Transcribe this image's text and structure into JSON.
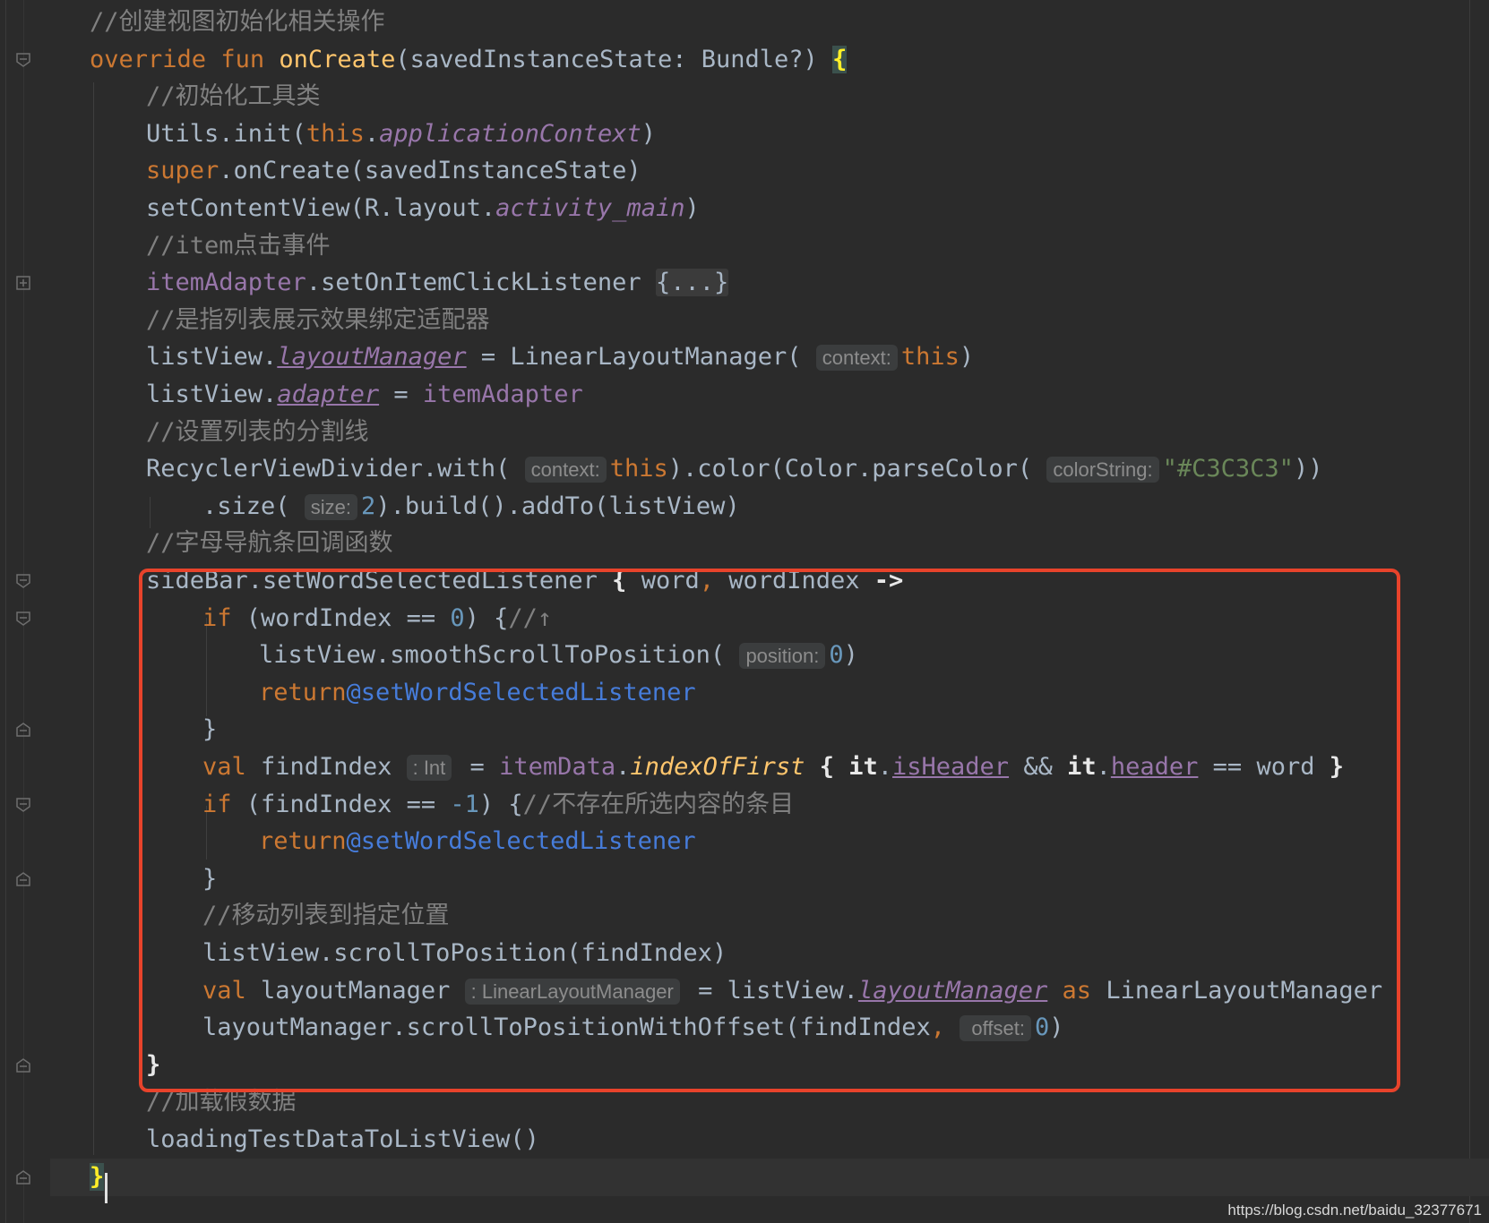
{
  "colors": {
    "background": "#2b2b2b",
    "keyword": "#cc7832",
    "function": "#ffc66d",
    "comment": "#808080",
    "property": "#9876aa",
    "label": "#467cda",
    "number": "#6897bb",
    "string": "#6a8759",
    "highlight_box": "#e8432b"
  },
  "code_lines": [
    {
      "indent": 0,
      "segs": [
        {
          "t": "//创建视图初始化相关操作",
          "c": "comment"
        }
      ]
    },
    {
      "indent": 0,
      "segs": [
        {
          "t": "override ",
          "c": "kw"
        },
        {
          "t": "fun ",
          "c": "kw"
        },
        {
          "t": "onCreate",
          "c": "fn"
        },
        {
          "t": "(savedInstanceState: Bundle?) ",
          "c": "plain"
        },
        {
          "t": "{",
          "c": "bracehl"
        }
      ]
    },
    {
      "indent": 1,
      "segs": [
        {
          "t": "//初始化工具类",
          "c": "comment"
        }
      ]
    },
    {
      "indent": 1,
      "segs": [
        {
          "t": "Utils.init(",
          "c": "plain"
        },
        {
          "t": "this",
          "c": "kw"
        },
        {
          "t": ".",
          "c": "plain"
        },
        {
          "t": "applicationContext",
          "c": "prop"
        },
        {
          "t": ")",
          "c": "plain"
        }
      ]
    },
    {
      "indent": 1,
      "segs": [
        {
          "t": "super",
          "c": "kw"
        },
        {
          "t": ".onCreate(savedInstanceState)",
          "c": "plain"
        }
      ]
    },
    {
      "indent": 1,
      "segs": [
        {
          "t": "setContentView(R.layout.",
          "c": "plain"
        },
        {
          "t": "activity_main",
          "c": "prop"
        },
        {
          "t": ")",
          "c": "plain"
        }
      ]
    },
    {
      "indent": 1,
      "segs": [
        {
          "t": "//item点击事件",
          "c": "comment"
        }
      ]
    },
    {
      "indent": 1,
      "segs": [
        {
          "t": "itemAdapter",
          "c": "field"
        },
        {
          "t": ".setOnItemClickListener ",
          "c": "plain"
        },
        {
          "t": "{...}",
          "c": "fold"
        }
      ]
    },
    {
      "indent": 1,
      "segs": [
        {
          "t": "//是指列表展示效果绑定适配器",
          "c": "comment"
        }
      ]
    },
    {
      "indent": 1,
      "segs": [
        {
          "t": "listView.",
          "c": "plain"
        },
        {
          "t": "layoutManager",
          "c": "propu"
        },
        {
          "t": " = LinearLayoutManager( ",
          "c": "plain"
        },
        {
          "t": "context:",
          "c": "hint"
        },
        {
          "t": "this",
          "c": "kw"
        },
        {
          "t": ")",
          "c": "plain"
        }
      ]
    },
    {
      "indent": 1,
      "segs": [
        {
          "t": "listView.",
          "c": "plain"
        },
        {
          "t": "adapter",
          "c": "propu"
        },
        {
          "t": " = ",
          "c": "plain"
        },
        {
          "t": "itemAdapter",
          "c": "field"
        }
      ]
    },
    {
      "indent": 1,
      "segs": [
        {
          "t": "//设置列表的分割线",
          "c": "comment"
        }
      ]
    },
    {
      "indent": 1,
      "segs": [
        {
          "t": "RecyclerViewDivider.with( ",
          "c": "plain"
        },
        {
          "t": "context:",
          "c": "hint"
        },
        {
          "t": "this",
          "c": "kw"
        },
        {
          "t": ").color(Color.parseColor( ",
          "c": "plain"
        },
        {
          "t": "colorString:",
          "c": "hint"
        },
        {
          "t": "\"#C3C3C3\"",
          "c": "str"
        },
        {
          "t": "))",
          "c": "plain"
        }
      ]
    },
    {
      "indent": 2,
      "segs": [
        {
          "t": ".size( ",
          "c": "plain"
        },
        {
          "t": "size:",
          "c": "hint"
        },
        {
          "t": "2",
          "c": "num"
        },
        {
          "t": ").build().addTo(listView)",
          "c": "plain"
        }
      ]
    },
    {
      "indent": 1,
      "segs": [
        {
          "t": "//字母导航条回调函数",
          "c": "comment"
        }
      ]
    },
    {
      "indent": 1,
      "segs": [
        {
          "t": "sideBar.setWordSelectedListener ",
          "c": "plain"
        },
        {
          "t": "{",
          "c": "brace"
        },
        {
          "t": " word",
          "c": "plain"
        },
        {
          "t": ",",
          "c": "kw"
        },
        {
          "t": " wordIndex ",
          "c": "plain"
        },
        {
          "t": "->",
          "c": "brace"
        }
      ]
    },
    {
      "indent": 2,
      "segs": [
        {
          "t": "if ",
          "c": "kw"
        },
        {
          "t": "(wordIndex == ",
          "c": "plain"
        },
        {
          "t": "0",
          "c": "num"
        },
        {
          "t": ") {",
          "c": "plain"
        },
        {
          "t": "//↑",
          "c": "comment"
        }
      ]
    },
    {
      "indent": 3,
      "segs": [
        {
          "t": "listView.smoothScrollToPosition( ",
          "c": "plain"
        },
        {
          "t": "position:",
          "c": "hint"
        },
        {
          "t": "0",
          "c": "num"
        },
        {
          "t": ")",
          "c": "plain"
        }
      ]
    },
    {
      "indent": 3,
      "segs": [
        {
          "t": "return",
          "c": "kw"
        },
        {
          "t": "@setWordSelectedListener",
          "c": "label"
        }
      ]
    },
    {
      "indent": 2,
      "segs": [
        {
          "t": "}",
          "c": "plain"
        }
      ]
    },
    {
      "indent": 2,
      "segs": [
        {
          "t": "val ",
          "c": "kw"
        },
        {
          "t": "findIndex ",
          "c": "plain"
        },
        {
          "t": ": Int",
          "c": "hint"
        },
        {
          "t": " = ",
          "c": "plain"
        },
        {
          "t": "itemData",
          "c": "field"
        },
        {
          "t": ".",
          "c": "plain"
        },
        {
          "t": "indexOfFirst",
          "c": "fn-it"
        },
        {
          "t": " { ",
          "c": "brace"
        },
        {
          "t": "it",
          "c": "brace"
        },
        {
          "t": ".",
          "c": "plain"
        },
        {
          "t": "isHeader",
          "c": "fieldu"
        },
        {
          "t": " && ",
          "c": "plain"
        },
        {
          "t": "it",
          "c": "brace"
        },
        {
          "t": ".",
          "c": "plain"
        },
        {
          "t": "header",
          "c": "fieldu"
        },
        {
          "t": " == word ",
          "c": "plain"
        },
        {
          "t": "}",
          "c": "brace"
        }
      ]
    },
    {
      "indent": 2,
      "segs": [
        {
          "t": "if ",
          "c": "kw"
        },
        {
          "t": "(findIndex == ",
          "c": "plain"
        },
        {
          "t": "-1",
          "c": "num"
        },
        {
          "t": ") {",
          "c": "plain"
        },
        {
          "t": "//不存在所选内容的条目",
          "c": "comment"
        }
      ]
    },
    {
      "indent": 3,
      "segs": [
        {
          "t": "return",
          "c": "kw"
        },
        {
          "t": "@setWordSelectedListener",
          "c": "label"
        }
      ]
    },
    {
      "indent": 2,
      "segs": [
        {
          "t": "}",
          "c": "plain"
        }
      ]
    },
    {
      "indent": 2,
      "segs": [
        {
          "t": "//移动列表到指定位置",
          "c": "comment"
        }
      ]
    },
    {
      "indent": 2,
      "segs": [
        {
          "t": "listView.scrollToPosition(findIndex)",
          "c": "plain"
        }
      ]
    },
    {
      "indent": 2,
      "segs": [
        {
          "t": "val ",
          "c": "kw"
        },
        {
          "t": "layoutManager ",
          "c": "plain"
        },
        {
          "t": ": LinearLayoutManager",
          "c": "hint"
        },
        {
          "t": " = listView.",
          "c": "plain"
        },
        {
          "t": "layoutManager",
          "c": "propu"
        },
        {
          "t": " as ",
          "c": "kw"
        },
        {
          "t": "LinearLayoutManager",
          "c": "plain"
        }
      ]
    },
    {
      "indent": 2,
      "segs": [
        {
          "t": "layoutManager.scrollToPositionWithOffset(findIndex",
          "c": "plain"
        },
        {
          "t": ", ",
          "c": "kw"
        },
        {
          "t": " offset:",
          "c": "hint"
        },
        {
          "t": "0",
          "c": "num"
        },
        {
          "t": ")",
          "c": "plain"
        }
      ]
    },
    {
      "indent": 1,
      "segs": [
        {
          "t": "}",
          "c": "brace"
        }
      ]
    },
    {
      "indent": 1,
      "segs": [
        {
          "t": "//加载假数据",
          "c": "comment"
        }
      ]
    },
    {
      "indent": 1,
      "segs": [
        {
          "t": "loadingTestDataToListView()",
          "c": "plain"
        }
      ]
    },
    {
      "indent": 0,
      "segs": [
        {
          "t": "}",
          "c": "bracehl"
        }
      ]
    }
  ],
  "gutter_icons": [
    "fold-collapse-icon",
    "fold-expand-icon",
    "fold-collapse-icon",
    "fold-collapse-icon",
    "fold-end-icon",
    "fold-collapse-icon",
    "fold-end-icon",
    "fold-end-icon",
    "fold-end-icon"
  ],
  "watermark": "https://blog.csdn.net/baidu_32377671"
}
